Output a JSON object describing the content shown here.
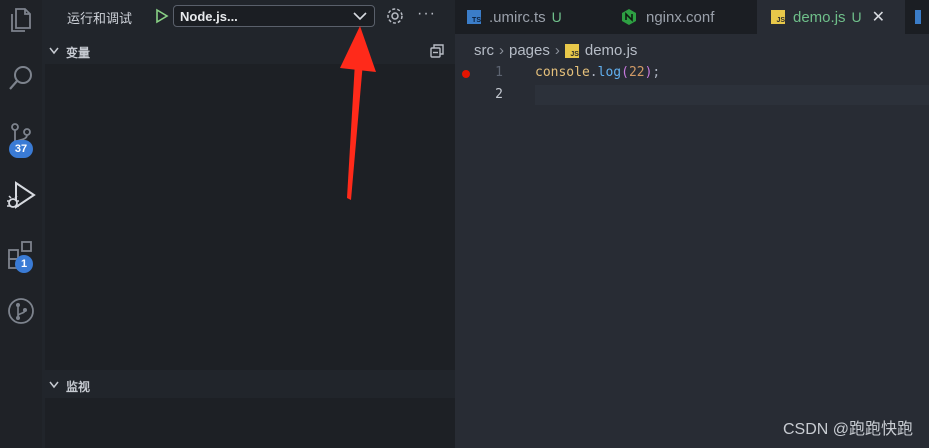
{
  "run_panel": {
    "title": "运行和调试",
    "config_selected": "Node.js...",
    "sections": {
      "variables": "变量",
      "watch": "监视"
    }
  },
  "activity": {
    "source_control_badge": "37",
    "extensions_badge": "1"
  },
  "tabs": [
    {
      "label": ".umirc.ts",
      "status": "U",
      "type": "ts"
    },
    {
      "label": "nginx.conf",
      "status": "",
      "type": "nginx"
    },
    {
      "label": "demo.js",
      "status": "U",
      "type": "js"
    }
  ],
  "file_icon_text": {
    "ts": "TS",
    "js": "JS"
  },
  "editor": {
    "breadcrumb": [
      "src",
      "pages",
      "demo.js"
    ],
    "lines": [
      {
        "number": "1",
        "tokens": [
          "console",
          ".",
          "log",
          "(",
          "22",
          ")",
          ";"
        ]
      },
      {
        "number": "2",
        "tokens": []
      }
    ]
  },
  "watermark": "CSDN @跑跑快跑",
  "colors": {
    "accent_green": "#6fbf8a",
    "breakpoint": "#e51400",
    "badge": "#3a7bd5",
    "arrow": "#ff2a1a"
  }
}
